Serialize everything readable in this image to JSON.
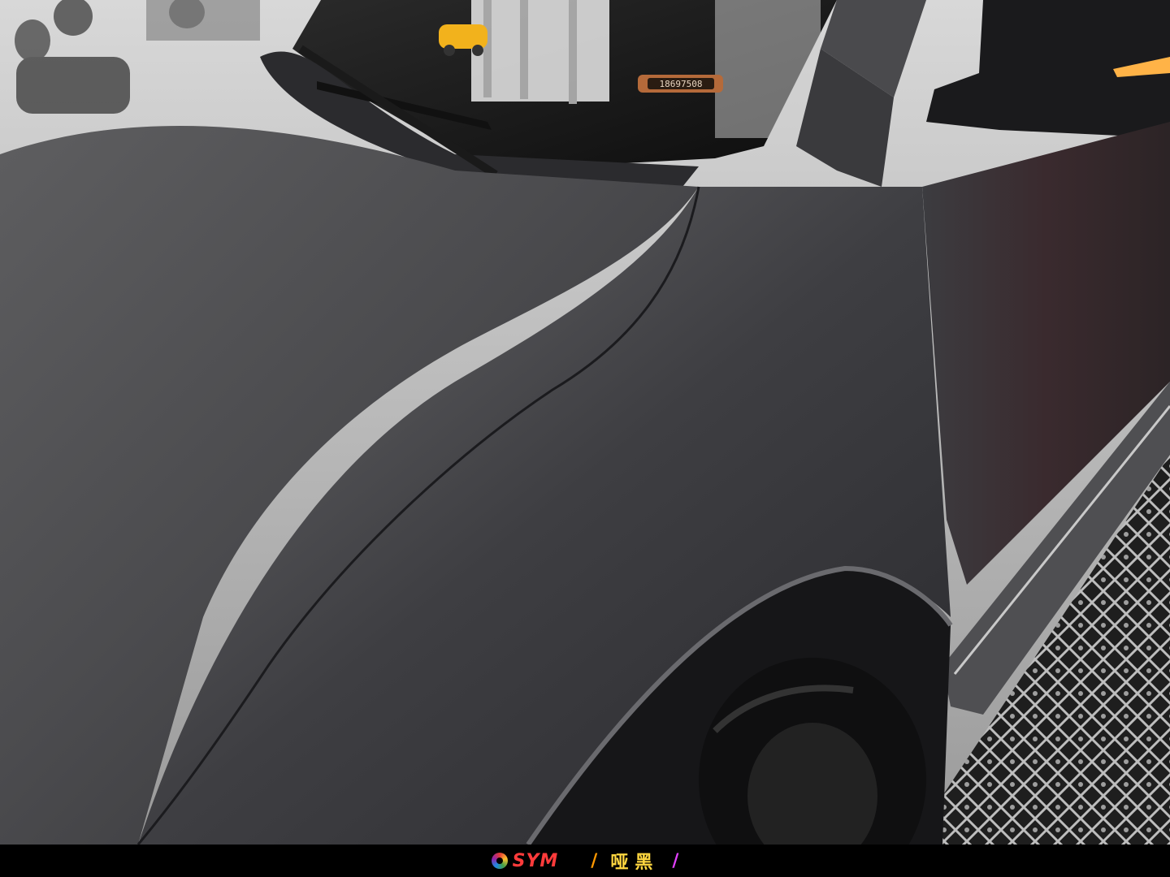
{
  "photo": {
    "subject": "matte black car body wrap, front fender and hood",
    "parking_plate_number": "18697508"
  },
  "caption": {
    "brand": "SYM",
    "tag_text": "哑黑",
    "left_mark": "/",
    "right_mark": "/"
  },
  "colors": {
    "caption_background": "#000000",
    "car_body": "#4a4a4d",
    "floor": "#8a8a8a"
  }
}
